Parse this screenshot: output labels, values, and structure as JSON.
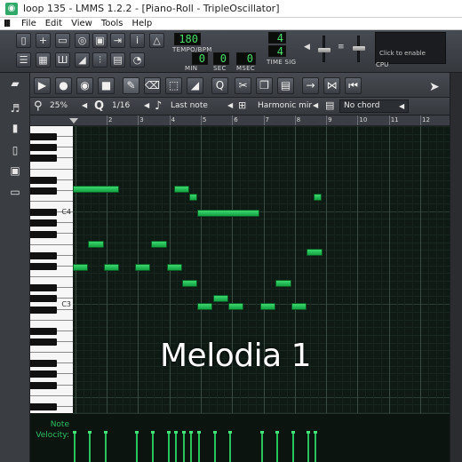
{
  "window": {
    "title": "loop 135 - LMMS 1.2.2 - [Piano-Roll - TripleOscillator]"
  },
  "menu": [
    "File",
    "Edit",
    "View",
    "Tools",
    "Help"
  ],
  "transport": {
    "tempo": "180",
    "tempo_label": "TEMPO/BPM",
    "min": "0",
    "sec": "0",
    "msec": "0",
    "min_label": "MIN",
    "sec_label": "SEC",
    "msec_label": "MSEC",
    "timesig_num": "4",
    "timesig_den": "4",
    "timesig_label": "TIME SIG",
    "cpu_hint": "Click to enable",
    "cpu_label": "CPU"
  },
  "piano_roll": {
    "zoom": "25%",
    "quantize": "1/16",
    "note_length": "Last note",
    "scale": "Harmonic mir",
    "chord": "No chord",
    "bar_numbers": [
      "2",
      "3",
      "4",
      "5",
      "6",
      "7",
      "8",
      "9",
      "10",
      "11",
      "12"
    ],
    "key_labels": [
      "C4",
      "C3"
    ]
  },
  "velocity": {
    "label_line1": "Note",
    "label_line2": "Velocity:"
  },
  "overlay": {
    "caption": "Melodia 1"
  },
  "colors": {
    "note": "#2fd064",
    "grid_bg": "#0f1a15",
    "toolbar": "#3e4147"
  }
}
